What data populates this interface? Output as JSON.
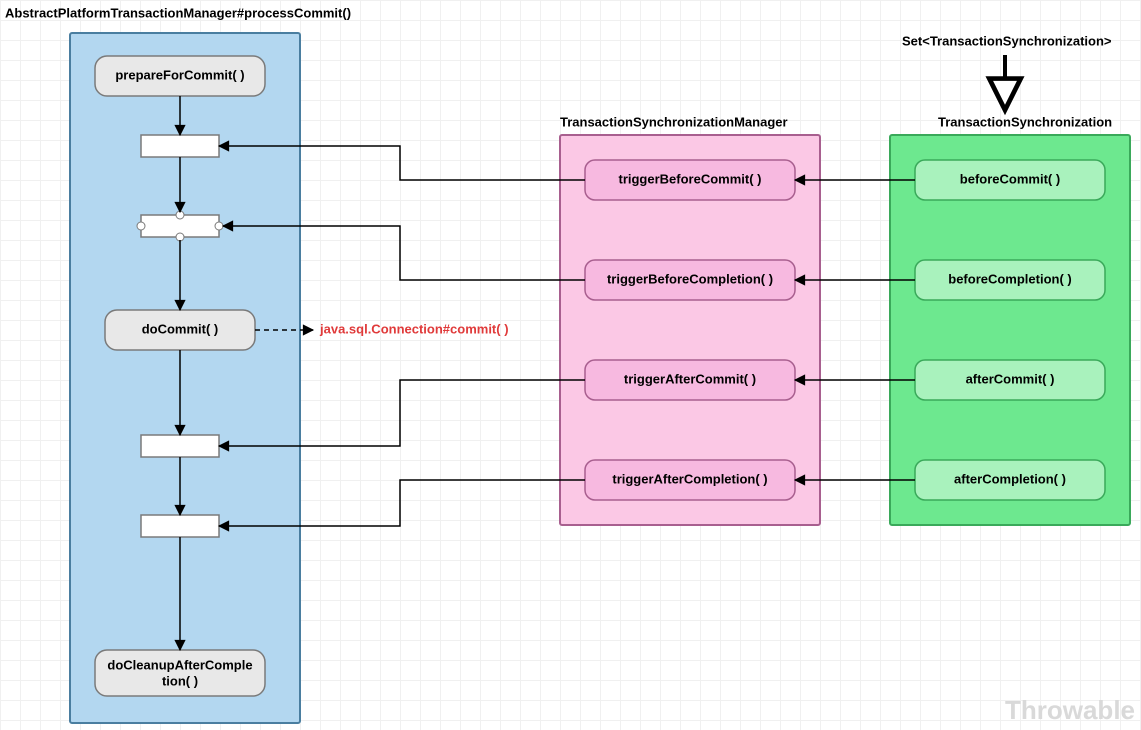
{
  "titles": {
    "main": "AbstractPlatformTransactionManager#processCommit()",
    "mgr": "TransactionSynchronizationManager",
    "sync": "TransactionSynchronization",
    "set": "Set<TransactionSynchronization>"
  },
  "left": {
    "prepare": "prepareForCommit( )",
    "doCommit": "doCommit( )",
    "cleanup1": "doCleanupAfterComple",
    "cleanup2": "tion( )"
  },
  "mgrNodes": {
    "tBeforeCommit": "triggerBeforeCommit( )",
    "tBeforeCompletion": "triggerBeforeCompletion( )",
    "tAfterCommit": "triggerAfterCommit( )",
    "tAfterCompletion": "triggerAfterCompletion( )"
  },
  "syncNodes": {
    "beforeCommit": "beforeCommit( )",
    "beforeCompletion": "beforeCompletion( )",
    "afterCommit": "afterCommit( )",
    "afterCompletion": "afterCompletion( )"
  },
  "annotation": "java.sql.Connection#commit( )",
  "watermark": "Throwable"
}
